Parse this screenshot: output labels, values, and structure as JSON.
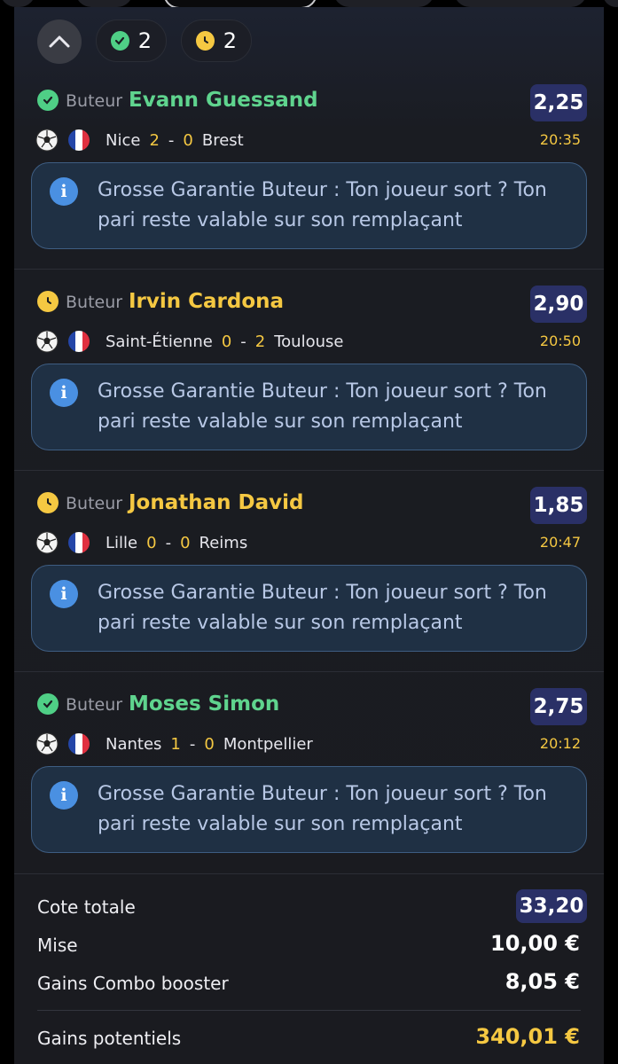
{
  "summary": {
    "won_count": "2",
    "pending_count": "2"
  },
  "selections": [
    {
      "status": "won",
      "bet_type": "Buteur",
      "player": "Evann Guessand",
      "odds": "2,25",
      "home": "Nice",
      "home_score": "2",
      "away_score": "0",
      "away": "Brest",
      "time": "20:35",
      "info": "Grosse Garantie Buteur : Ton joueur sort ? Ton pari reste valable sur son remplaçant"
    },
    {
      "status": "pending",
      "bet_type": "Buteur",
      "player": "Irvin Cardona",
      "odds": "2,90",
      "home": "Saint-Étienne",
      "home_score": "0",
      "away_score": "2",
      "away": "Toulouse",
      "time": "20:50",
      "info": "Grosse Garantie Buteur : Ton joueur sort ? Ton pari reste valable sur son remplaçant"
    },
    {
      "status": "pending",
      "bet_type": "Buteur",
      "player": "Jonathan David",
      "odds": "1,85",
      "home": "Lille",
      "home_score": "0",
      "away_score": "0",
      "away": "Reims",
      "time": "20:47",
      "info": "Grosse Garantie Buteur : Ton joueur sort ? Ton pari reste valable sur son remplaçant"
    },
    {
      "status": "won",
      "bet_type": "Buteur",
      "player": "Moses Simon",
      "odds": "2,75",
      "home": "Nantes",
      "home_score": "1",
      "away_score": "0",
      "away": "Montpellier",
      "time": "20:12",
      "info": "Grosse Garantie Buteur : Ton joueur sort ? Ton pari reste valable sur son remplaçant"
    }
  ],
  "totals": {
    "odds_label": "Cote totale",
    "odds_value": "33,20",
    "stake_label": "Mise",
    "stake_value": "10,00 €",
    "booster_label": "Gains Combo booster",
    "booster_value": "8,05 €",
    "potential_label": "Gains potentiels",
    "potential_value": "340,01 €"
  },
  "colors": {
    "won": "#5fd48e",
    "pending": "#f5c842",
    "odds_badge": "#2a3066",
    "info_bg": "#1f3044"
  },
  "icons": {
    "collapse": "chevron-up-icon",
    "won": "check-circle-icon",
    "pending": "clock-icon",
    "sport": "soccer-ball-icon",
    "flag": "france-flag-icon",
    "info": "info-icon"
  }
}
